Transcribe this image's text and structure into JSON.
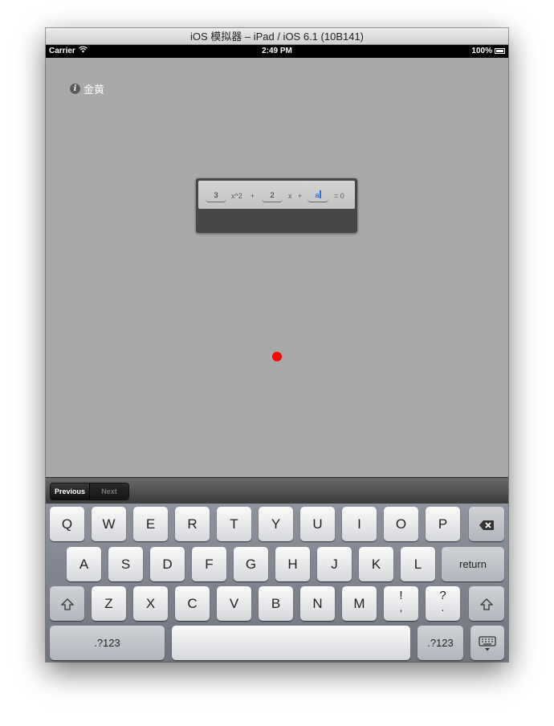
{
  "window": {
    "title": "iOS 模拟器 – iPad / iOS 6.1 (10B141)"
  },
  "status_bar": {
    "carrier": "Carrier",
    "time": "2:49 PM",
    "battery_percent": "100%"
  },
  "info": {
    "label": "金黄",
    "icon": "info-icon"
  },
  "equation": {
    "coefficient_a": "3",
    "term_a": "x^2",
    "plus_1": "+",
    "coefficient_b": "2",
    "term_b": "x",
    "plus_2": "+",
    "coefficient_c": "a",
    "equals": "= 0"
  },
  "marker": {
    "color": "#ff0000"
  },
  "accessory": {
    "previous_label": "Previous",
    "next_label": "Next"
  },
  "keyboard": {
    "row1": [
      "Q",
      "W",
      "E",
      "R",
      "T",
      "Y",
      "U",
      "I",
      "O",
      "P"
    ],
    "row2": [
      "A",
      "S",
      "D",
      "F",
      "G",
      "H",
      "J",
      "K",
      "L"
    ],
    "row3": [
      "Z",
      "X",
      "C",
      "V",
      "B",
      "N",
      "M"
    ],
    "return_label": "return",
    "symbol_keys": [
      {
        "top": "!",
        "bottom": ","
      },
      {
        "top": "?",
        "bottom": "."
      }
    ],
    "numbers_label": ".?123",
    "icons": [
      "backspace-icon",
      "shift-icon",
      "keyboard-dismiss-icon"
    ]
  }
}
